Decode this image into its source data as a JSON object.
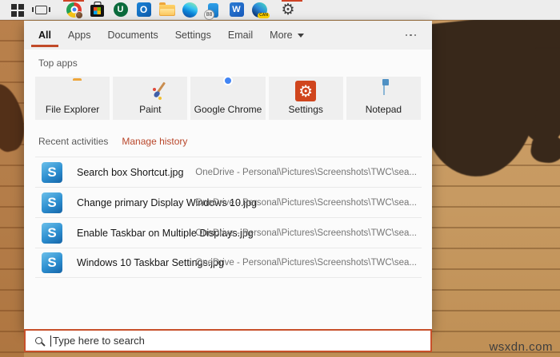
{
  "colors": {
    "accent": "#c14a28",
    "taskbar_bg": "#ededed",
    "panel_bg": "#fbfbfb",
    "file_icon_blue": "#2d8fd0",
    "map_brown": "#38281a",
    "wood_tan": "#c79a62"
  },
  "taskbar": {
    "phone_badge": "88",
    "canary_badge": "CAN",
    "u_letter": "U",
    "outlook_letter": "O",
    "word_letter": "W",
    "gear_glyph": "⚙"
  },
  "search_panel": {
    "tabs": [
      {
        "label": "All",
        "active": true
      },
      {
        "label": "Apps"
      },
      {
        "label": "Documents"
      },
      {
        "label": "Settings"
      },
      {
        "label": "Email"
      },
      {
        "label": "More"
      }
    ],
    "top_apps": {
      "title": "Top apps",
      "apps": [
        {
          "label": "File Explorer"
        },
        {
          "label": "Paint"
        },
        {
          "label": "Google Chrome"
        },
        {
          "label": "Settings",
          "gear_glyph": "⚙"
        },
        {
          "label": "Notepad"
        }
      ]
    },
    "recent": {
      "title": "Recent activities",
      "manage_link": "Manage history",
      "icon_letter": "S",
      "items": [
        {
          "title": "Search box Shortcut.jpg",
          "path": "OneDrive - Personal\\Pictures\\Screenshots\\TWC\\sea..."
        },
        {
          "title": "Change primary Display Windows 10.jpg",
          "path": "OneDrive - Personal\\Pictures\\Screenshots\\TWC\\sea..."
        },
        {
          "title": "Enable Taskbar on Multiple Displays.jpg",
          "path": "OneDrive - Personal\\Pictures\\Screenshots\\TWC\\sea..."
        },
        {
          "title": "Windows 10 Taskbar Settings.jpg",
          "path": "OneDrive - Personal\\Pictures\\Screenshots\\TWC\\sea..."
        }
      ]
    }
  },
  "search_box": {
    "placeholder": "Type here to search"
  },
  "watermark": "wsxdn.com"
}
